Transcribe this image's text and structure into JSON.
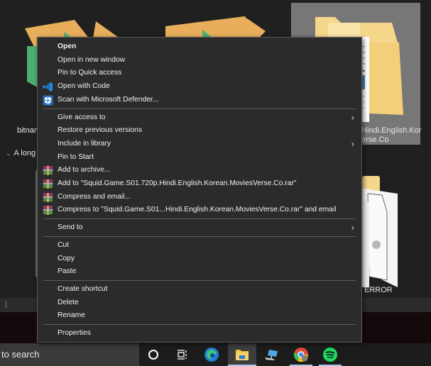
{
  "explorer": {
    "items": [
      {
        "name": "bitnam",
        "icon": "box-icon"
      },
      {
        "name": "",
        "icon": "box-icon"
      },
      {
        "name": ".Hindi.English.Kor",
        "name_line2": "/erse.Co",
        "icon": "folder-with-documents-icon",
        "selected": true
      },
      {
        "name": "ERROR",
        "icon": "folder-with-files-icon"
      }
    ],
    "group_header": "A long",
    "group_chevron": "⌄"
  },
  "context_menu": {
    "items": [
      {
        "label": "Open",
        "bold": true
      },
      {
        "label": "Open in new window"
      },
      {
        "label": "Pin to Quick access"
      },
      {
        "label": "Open with Code",
        "icon": "vscode-icon"
      },
      {
        "label": "Scan with Microsoft Defender...",
        "icon": "defender-shield-icon"
      },
      {
        "separator": true
      },
      {
        "label": "Give access to",
        "submenu": true
      },
      {
        "label": "Restore previous versions"
      },
      {
        "label": "Include in library",
        "submenu": true
      },
      {
        "label": "Pin to Start"
      },
      {
        "label": "Add to archive...",
        "icon": "winrar-icon"
      },
      {
        "label": "Add to \"Squid.Game.S01.720p.Hindi.English.Korean.MoviesVerse.Co.rar\"",
        "icon": "winrar-icon"
      },
      {
        "label": "Compress and email...",
        "icon": "winrar-icon"
      },
      {
        "label": "Compress to \"Squid.Game.S01...Hindi.English.Korean.MoviesVerse.Co.rar\" and email",
        "icon": "winrar-icon"
      },
      {
        "separator": true
      },
      {
        "label": "Send to",
        "submenu": true
      },
      {
        "separator": true
      },
      {
        "label": "Cut"
      },
      {
        "label": "Copy"
      },
      {
        "label": "Paste"
      },
      {
        "separator": true
      },
      {
        "label": "Create shortcut"
      },
      {
        "label": "Delete"
      },
      {
        "label": "Rename"
      },
      {
        "separator": true
      },
      {
        "label": "Properties"
      }
    ],
    "submenu_arrow": "›"
  },
  "taskbar": {
    "search_text": "to search",
    "buttons": [
      {
        "name": "cortana",
        "icon": "cortana-circle-icon"
      },
      {
        "name": "task-view",
        "icon": "task-view-icon"
      },
      {
        "name": "edge",
        "icon": "edge-icon"
      },
      {
        "name": "file-explorer",
        "icon": "file-explorer-icon",
        "active": true
      },
      {
        "name": "this-pc",
        "icon": "computer-icon"
      },
      {
        "name": "chrome",
        "icon": "chrome-icon",
        "running": true
      },
      {
        "name": "spotify",
        "icon": "spotify-icon",
        "running": true
      }
    ]
  },
  "colors": {
    "menu_bg": "#2b2b2b",
    "menu_border": "#5a5a5a",
    "selection_bg": "#777777",
    "taskbar_bg": "#1c1c1c",
    "accent_underline": "#a9c6e8",
    "spotify_green": "#1ed760"
  }
}
